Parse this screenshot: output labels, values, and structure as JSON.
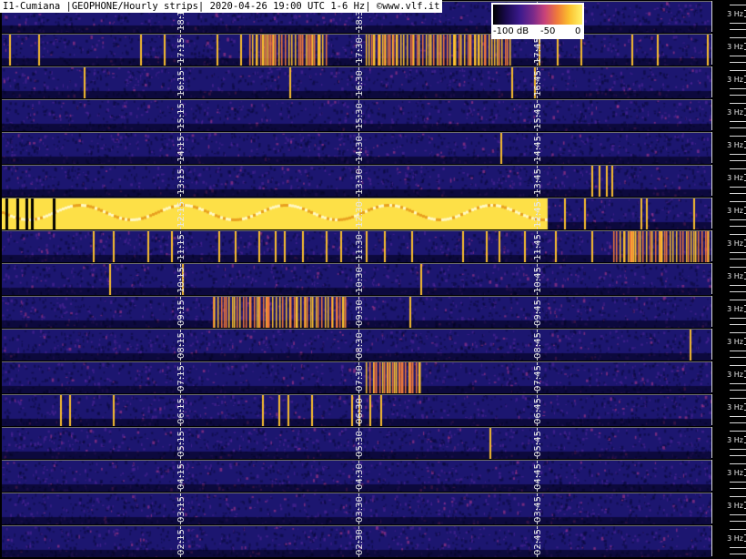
{
  "title": "I1-Cumiana |GEOPHONE/Hourly strips| 2020-04-26 19:00 UTC 1-6 Hz| ©www.vlf.it",
  "legend": {
    "min": "-100 dB",
    "mid": "-50",
    "max": "0"
  },
  "axis_label": "3 Hz",
  "strips": [
    {
      "labels": [
        "18:15",
        "18:30",
        "18:45"
      ]
    },
    {
      "labels": [
        "17:15",
        "17:30",
        "17:45"
      ]
    },
    {
      "labels": [
        "16:15",
        "16:30",
        "16:45"
      ]
    },
    {
      "labels": [
        "15:15",
        "15:30",
        "15:45"
      ]
    },
    {
      "labels": [
        "14:15",
        "14:30",
        "14:45"
      ]
    },
    {
      "labels": [
        "13:15",
        "13:30",
        "13:45"
      ]
    },
    {
      "labels": [
        "12:15",
        "12:30",
        "12:45"
      ]
    },
    {
      "labels": [
        "11:15",
        "11:30",
        "11:45"
      ]
    },
    {
      "labels": [
        "10:15",
        "10:30",
        "10:45"
      ]
    },
    {
      "labels": [
        "09:15",
        "09:30",
        "09:45"
      ]
    },
    {
      "labels": [
        "08:15",
        "08:30",
        "08:45"
      ]
    },
    {
      "labels": [
        "07:15",
        "07:30",
        "07:45"
      ]
    },
    {
      "labels": [
        "06:15",
        "06:30",
        "06:45"
      ]
    },
    {
      "labels": [
        "05:15",
        "05:30",
        "05:45"
      ]
    },
    {
      "labels": [
        "04:15",
        "04:30",
        "04:45"
      ]
    },
    {
      "labels": [
        "03:15",
        "03:30",
        "03:45"
      ]
    },
    {
      "labels": [
        "02:15",
        "02:30",
        "02:45"
      ]
    }
  ],
  "colors": {
    "background": "#1c1670",
    "line_hot": "#fbbf2e",
    "separator": "#6f6f6f"
  }
}
